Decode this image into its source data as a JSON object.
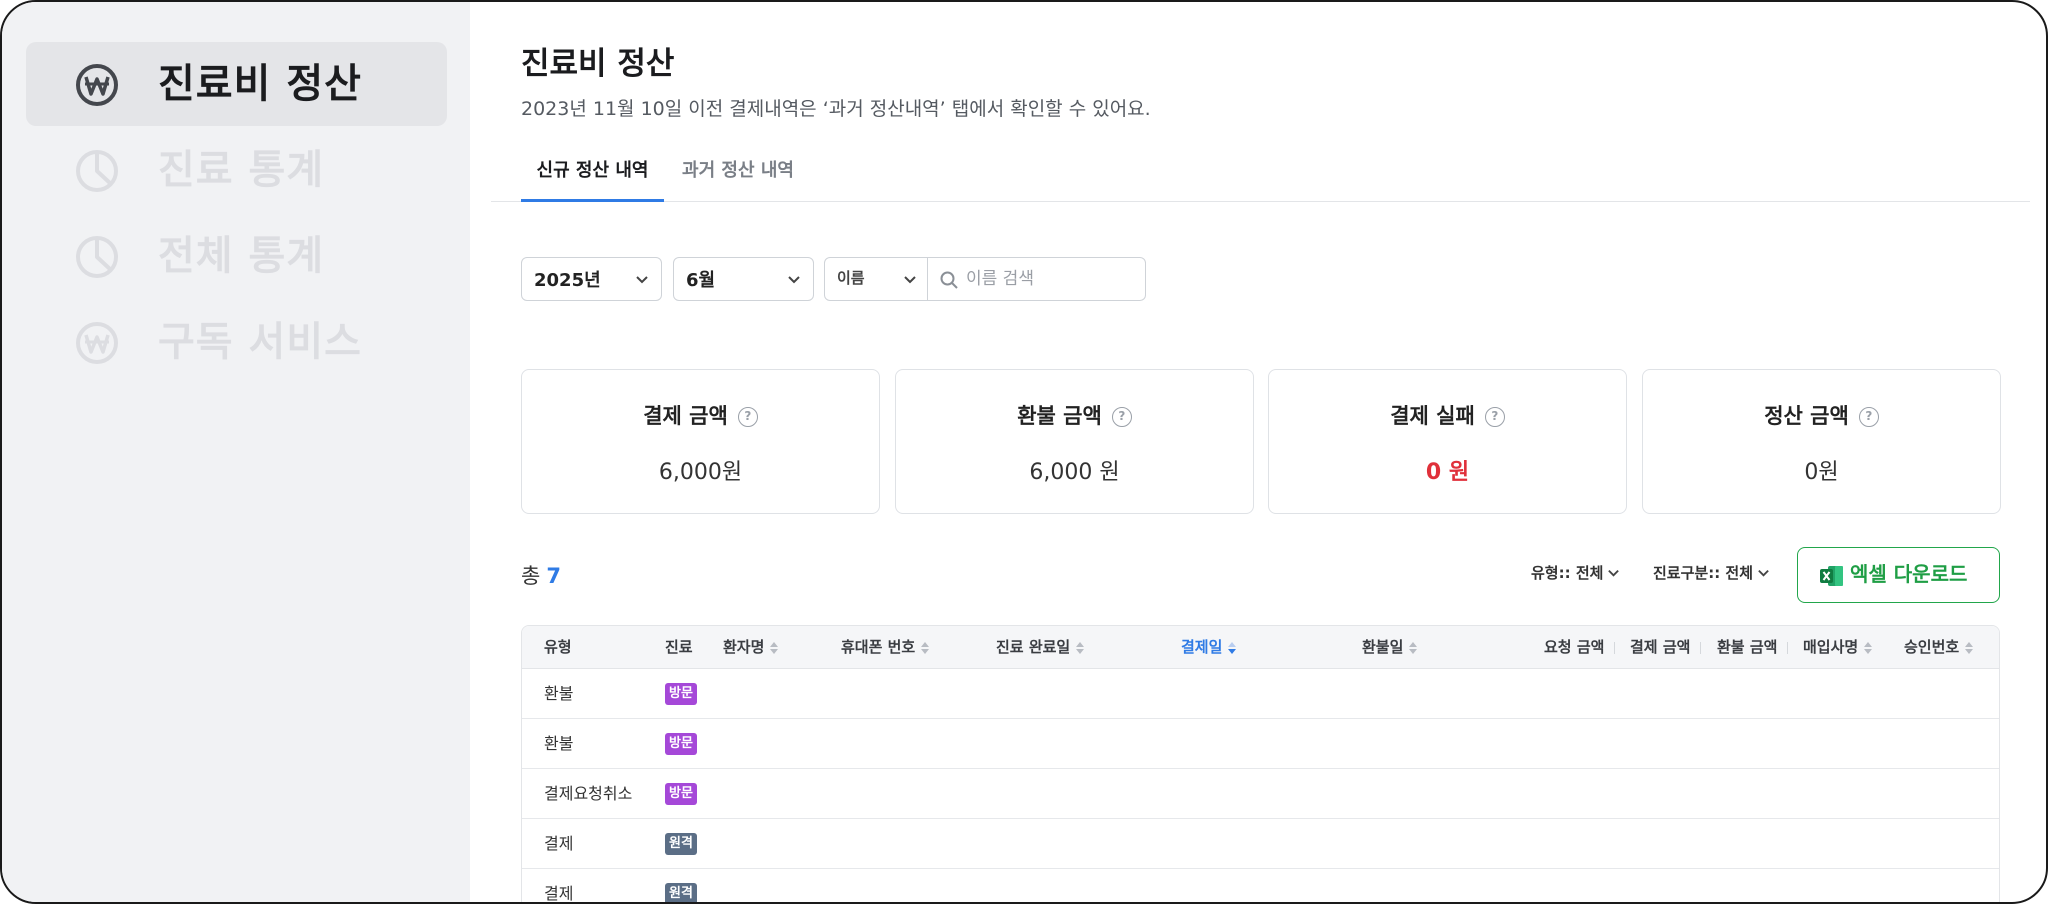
{
  "sidebar": {
    "items": [
      {
        "label": "진료비 정산",
        "icon": "won-icon",
        "active": true
      },
      {
        "label": "진료 통계",
        "icon": "pie-chart-icon",
        "active": false
      },
      {
        "label": "전체 통계",
        "icon": "pie-chart-icon",
        "active": false
      },
      {
        "label": "구독 서비스",
        "icon": "won-icon",
        "active": false
      }
    ]
  },
  "header": {
    "title": "진료비 정산",
    "subtitle": "2023년 11월 10일 이전 결제내역은 ‘과거 정산내역’ 탭에서 확인할 수 있어요."
  },
  "tabs": [
    {
      "label": "신규 정산 내역",
      "active": true
    },
    {
      "label": "과거 정산 내역",
      "active": false
    }
  ],
  "filters": {
    "year": "2025년",
    "month": "6월",
    "search_field": "이름",
    "search_placeholder": "이름 검색"
  },
  "cards": [
    {
      "title": "결제 금액",
      "value": "6,000원"
    },
    {
      "title": "환불 금액",
      "value": "6,000 원"
    },
    {
      "title": "결제 실패",
      "value": "0 원"
    },
    {
      "title": "정산 금액",
      "value": "0원"
    }
  ],
  "summary": {
    "total_label": "총",
    "total_count": "7"
  },
  "toolbar": {
    "type_filter": "유형:: 전체",
    "category_filter": "진료구분:: 전체",
    "excel_button": "엑셀 다운로드"
  },
  "table": {
    "columns": [
      "유형",
      "진료",
      "환자명",
      "휴대폰 번호",
      "진료 완료일",
      "결제일",
      "환불일",
      "요청 금액",
      "결제 금액",
      "환불 금액",
      "매입사명",
      "승인번호"
    ],
    "rows": [
      {
        "type": "환불",
        "badge": "방문"
      },
      {
        "type": "환불",
        "badge": "방문"
      },
      {
        "type": "결제요청취소",
        "badge": "방문"
      },
      {
        "type": "결제",
        "badge": "원격"
      },
      {
        "type": "결제",
        "badge": "원격"
      }
    ]
  },
  "colors": {
    "accent": "#2f7be5",
    "fail": "#e0303a",
    "excel_green": "#1f9e45",
    "badge_visit": "#a548d8",
    "badge_remote": "#5b6e86"
  }
}
